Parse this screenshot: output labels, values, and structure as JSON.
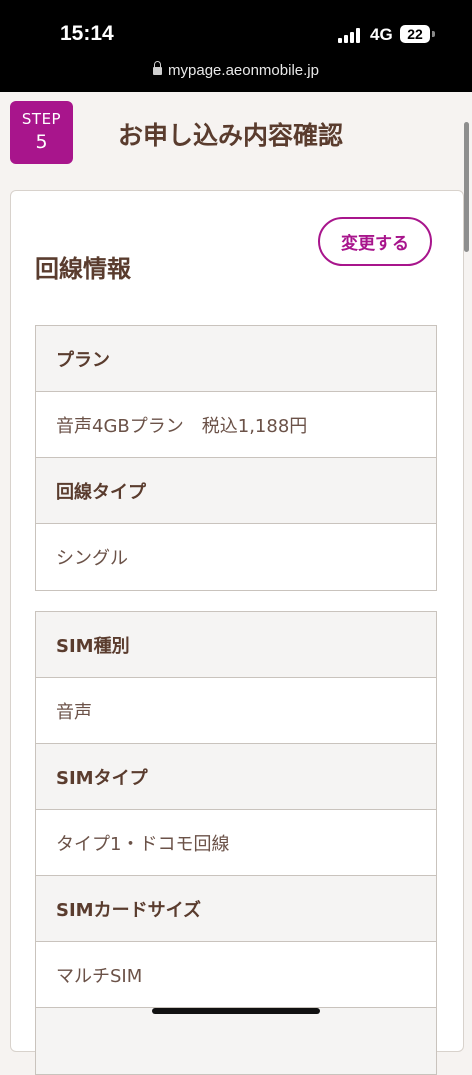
{
  "status_bar": {
    "time": "15:14",
    "network": "4G",
    "battery": "22",
    "url": "mypage.aeonmobile.jp"
  },
  "header": {
    "step_label": "STEP",
    "step_number": "5",
    "title": "お申し込み内容確認"
  },
  "section": {
    "title": "回線情報",
    "change_button": "変更する"
  },
  "line_table": [
    {
      "label": "プラン",
      "value": "音声4GBプラン　税込1,188円"
    },
    {
      "label": "回線タイプ",
      "value": "シングル"
    }
  ],
  "sim_table": [
    {
      "label": "SIM種別",
      "value": "音声"
    },
    {
      "label": "SIMタイプ",
      "value": "タイプ1・ドコモ回線"
    },
    {
      "label": "SIMカードサイズ",
      "value": "マルチSIM"
    }
  ],
  "colors": {
    "accent": "#a8158c",
    "text": "#5a3c2e",
    "status_bar_bg": "#000000"
  }
}
